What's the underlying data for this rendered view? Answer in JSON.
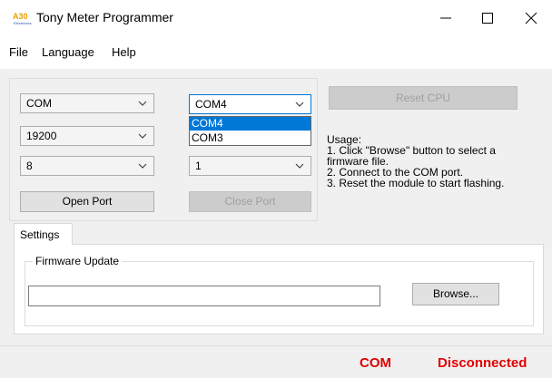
{
  "window": {
    "title": "Tony Meter Programmer",
    "logo_text": "A30",
    "logo_subtext": "Electronics",
    "minimize_icon": "minimize-icon",
    "maximize_icon": "maximize-icon",
    "close_icon": "close-icon"
  },
  "menu": {
    "file": "File",
    "language": "Language",
    "help": "Help"
  },
  "port_settings": {
    "port_type": "COM",
    "baud_rate": "19200",
    "data_bits": "8",
    "com_port": "COM4",
    "stop_bits": "1",
    "com_options": [
      "COM4",
      "COM3"
    ],
    "open_port_label": "Open Port",
    "close_port_label": "Close Port"
  },
  "reset_cpu_label": "Reset CPU",
  "usage": {
    "title": "Usage:",
    "line1": "1. Click \"Browse\" button to select a",
    "line2": "firmware file.",
    "line3": "2. Connect to the COM port.",
    "line4": "3. Reset the module to start flashing."
  },
  "tabs": {
    "settings": "Settings"
  },
  "firmware": {
    "legend": "Firmware Update",
    "path_value": "",
    "browse_label": "Browse..."
  },
  "status": {
    "port": "COM",
    "connection": "Disconnected",
    "color": "#e00000"
  },
  "colors": {
    "accent": "#0078d7"
  }
}
